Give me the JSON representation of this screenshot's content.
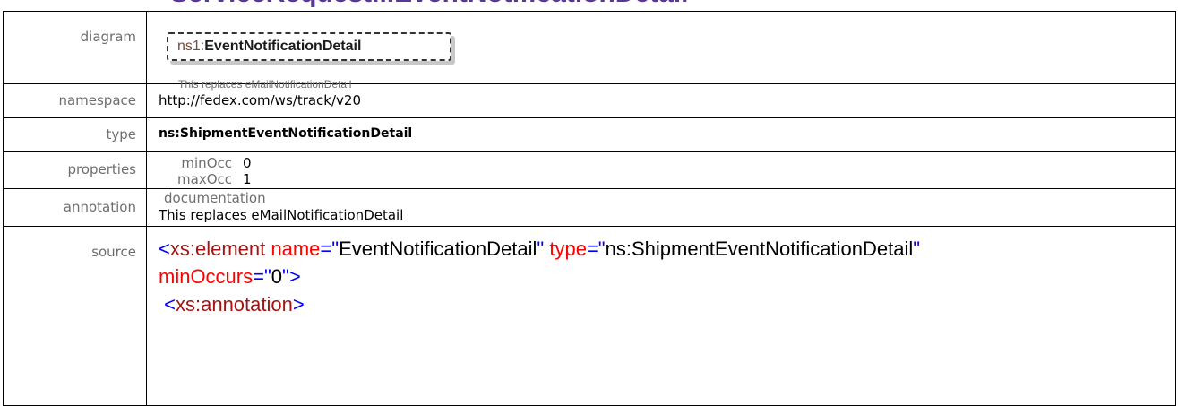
{
  "page_title": "ServiceRequest...EventNotificationDetail",
  "rows": {
    "diagram": {
      "label": "diagram"
    },
    "namespace": {
      "label": "namespace",
      "value": "http://fedex.com/ws/track/v20"
    },
    "type": {
      "label": "type",
      "value": "ns:ShipmentEventNotificationDetail"
    },
    "properties": {
      "label": "properties",
      "items": [
        {
          "key": "minOcc",
          "value": "0"
        },
        {
          "key": "maxOcc",
          "value": "1"
        }
      ]
    },
    "annotation": {
      "label": "annotation",
      "key": "documentation",
      "text": "This replaces eMailNotificationDetail"
    },
    "source": {
      "label": "source",
      "line1_open": "<",
      "line1_tag": "xs:element",
      "line1_attr1": " name",
      "line1_eq1": "=\"",
      "line1_val1": "EventNotificationDetail",
      "line1_q1": "\"",
      "line1_attr2": " type",
      "line1_eq2": "=\"",
      "line1_val2": "ns:ShipmentEventNotificationDetail",
      "line1_q2": "\"",
      "line2_attr": "minOccurs",
      "line2_eq": "=\"",
      "line2_val": "0",
      "line2_close": "\">",
      "line3_open": " <",
      "line3_tag": "xs:annotation",
      "line3_close": ">"
    }
  },
  "diagram": {
    "prefix": "ns1:",
    "name": "EventNotificationDetail",
    "caption": "This replaces eMailNotificationDetail"
  },
  "colors": {
    "title": "#5a3696",
    "tag": "#a31515",
    "attr": "#ff0000",
    "punct": "#0000ff"
  }
}
